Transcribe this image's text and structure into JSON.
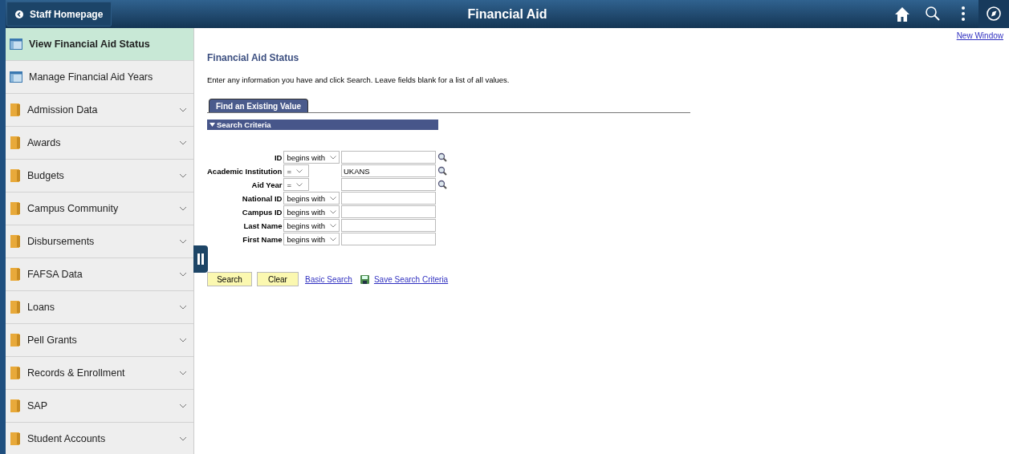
{
  "header": {
    "back_button": "Staff Homepage",
    "title": "Financial Aid"
  },
  "sidebar": {
    "items": [
      {
        "kind": "page",
        "label": "View Financial Aid Status",
        "selected": true
      },
      {
        "kind": "page",
        "label": "Manage Financial Aid Years",
        "selected": false
      },
      {
        "kind": "folder",
        "label": "Admission Data",
        "selected": false,
        "expanded": false
      },
      {
        "kind": "folder",
        "label": "Awards",
        "selected": false,
        "expanded": false
      },
      {
        "kind": "folder",
        "label": "Budgets",
        "selected": false,
        "expanded": false
      },
      {
        "kind": "folder",
        "label": "Campus Community",
        "selected": false,
        "expanded": false
      },
      {
        "kind": "folder",
        "label": "Disbursements",
        "selected": false,
        "expanded": false
      },
      {
        "kind": "folder",
        "label": "FAFSA Data",
        "selected": false,
        "expanded": false
      },
      {
        "kind": "folder",
        "label": "Loans",
        "selected": false,
        "expanded": false
      },
      {
        "kind": "folder",
        "label": "Pell Grants",
        "selected": false,
        "expanded": false
      },
      {
        "kind": "folder",
        "label": "Records & Enrollment",
        "selected": false,
        "expanded": false
      },
      {
        "kind": "folder",
        "label": "SAP",
        "selected": false,
        "expanded": false
      },
      {
        "kind": "folder",
        "label": "Student Accounts",
        "selected": false,
        "expanded": false
      }
    ]
  },
  "content": {
    "new_window_link": "New Window",
    "title": "Financial Aid Status",
    "instructions": "Enter any information you have and click Search. Leave fields blank for a list of all values.",
    "tabs": [
      {
        "label": "Find an Existing Value",
        "selected": true
      }
    ],
    "section": {
      "title": "Search Criteria",
      "expanded": true
    },
    "fields": [
      {
        "label": "ID",
        "operator": "begins with",
        "lookup": true
      },
      {
        "label": "Academic Institution",
        "operator": "=",
        "value": "UKANS",
        "lookup": true
      },
      {
        "label": "Aid Year",
        "operator": "=",
        "lookup": true
      },
      {
        "label": "National ID",
        "operator": "begins with",
        "lookup": false
      },
      {
        "label": "Campus ID",
        "operator": "begins with",
        "lookup": false
      },
      {
        "label": "Last Name",
        "operator": "begins with",
        "lookup": false
      },
      {
        "label": "First Name",
        "operator": "begins with",
        "lookup": false
      }
    ],
    "buttons": [
      "Search",
      "Clear"
    ],
    "links": [
      "Basic Search",
      "Save Search Criteria"
    ]
  }
}
